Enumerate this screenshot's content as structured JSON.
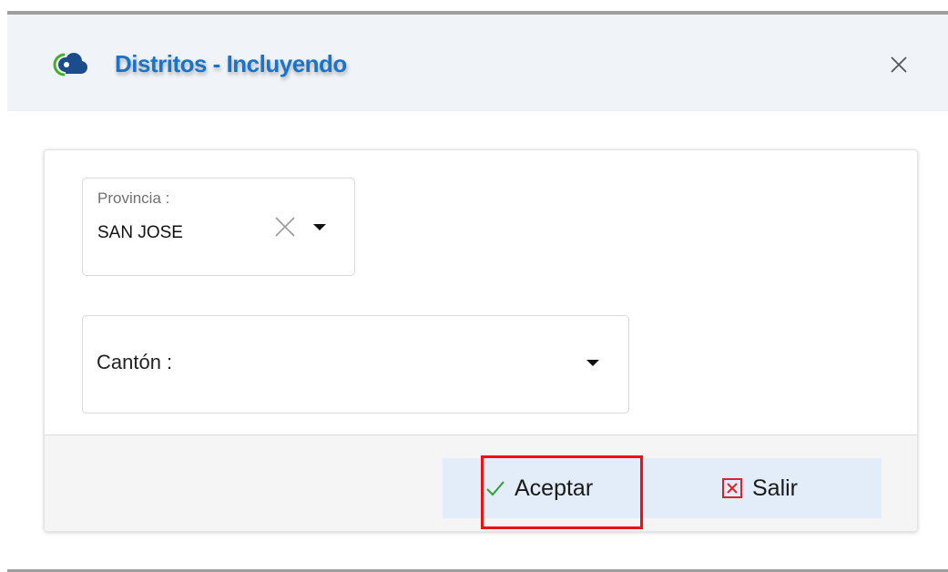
{
  "dialog": {
    "title": "Distritos - Incluyendo",
    "colors": {
      "title": "#1a73c8",
      "logo_primary": "#1b4d8c",
      "logo_accent": "#43b02a"
    }
  },
  "form": {
    "provincia": {
      "label": "Provincia :",
      "value": "SAN JOSE"
    },
    "canton": {
      "label": "Cantón :",
      "value": ""
    }
  },
  "footer": {
    "accept_label": "Aceptar",
    "accept_icon": "check-icon",
    "exit_label": "Salir",
    "exit_icon": "close-box-icon",
    "accept_check_color": "#2e9e3a",
    "exit_icon_color": "#e0202a",
    "highlight_color": "#ee1111"
  }
}
